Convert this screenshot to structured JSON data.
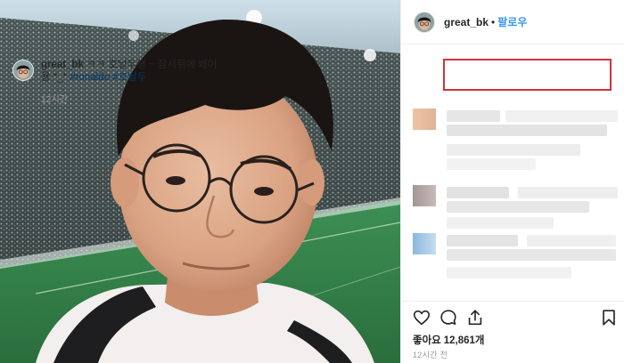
{
  "post": {
    "username": "great_bk",
    "follow_label": "팔로우",
    "separator": "•"
  },
  "caption": {
    "username": "great_bk",
    "text": " ㅋㅋ 호날두형 ~ 잠시뒤에 봬어용 *_* ",
    "tags": [
      "#ronaldo",
      "#호날두"
    ],
    "time": "12시간"
  },
  "comments": {
    "blurred": true,
    "count": 3
  },
  "actions": {
    "icons": [
      "heart-icon",
      "comment-icon",
      "share-icon",
      "bookmark-icon"
    ]
  },
  "likes": {
    "label": "좋아요",
    "count": "12,861개"
  },
  "timestamp": "12시간 전",
  "colors": {
    "follow": "#3897f0",
    "hashtag": "#003569",
    "highlight": "#d4323c",
    "muted": "#999999"
  }
}
